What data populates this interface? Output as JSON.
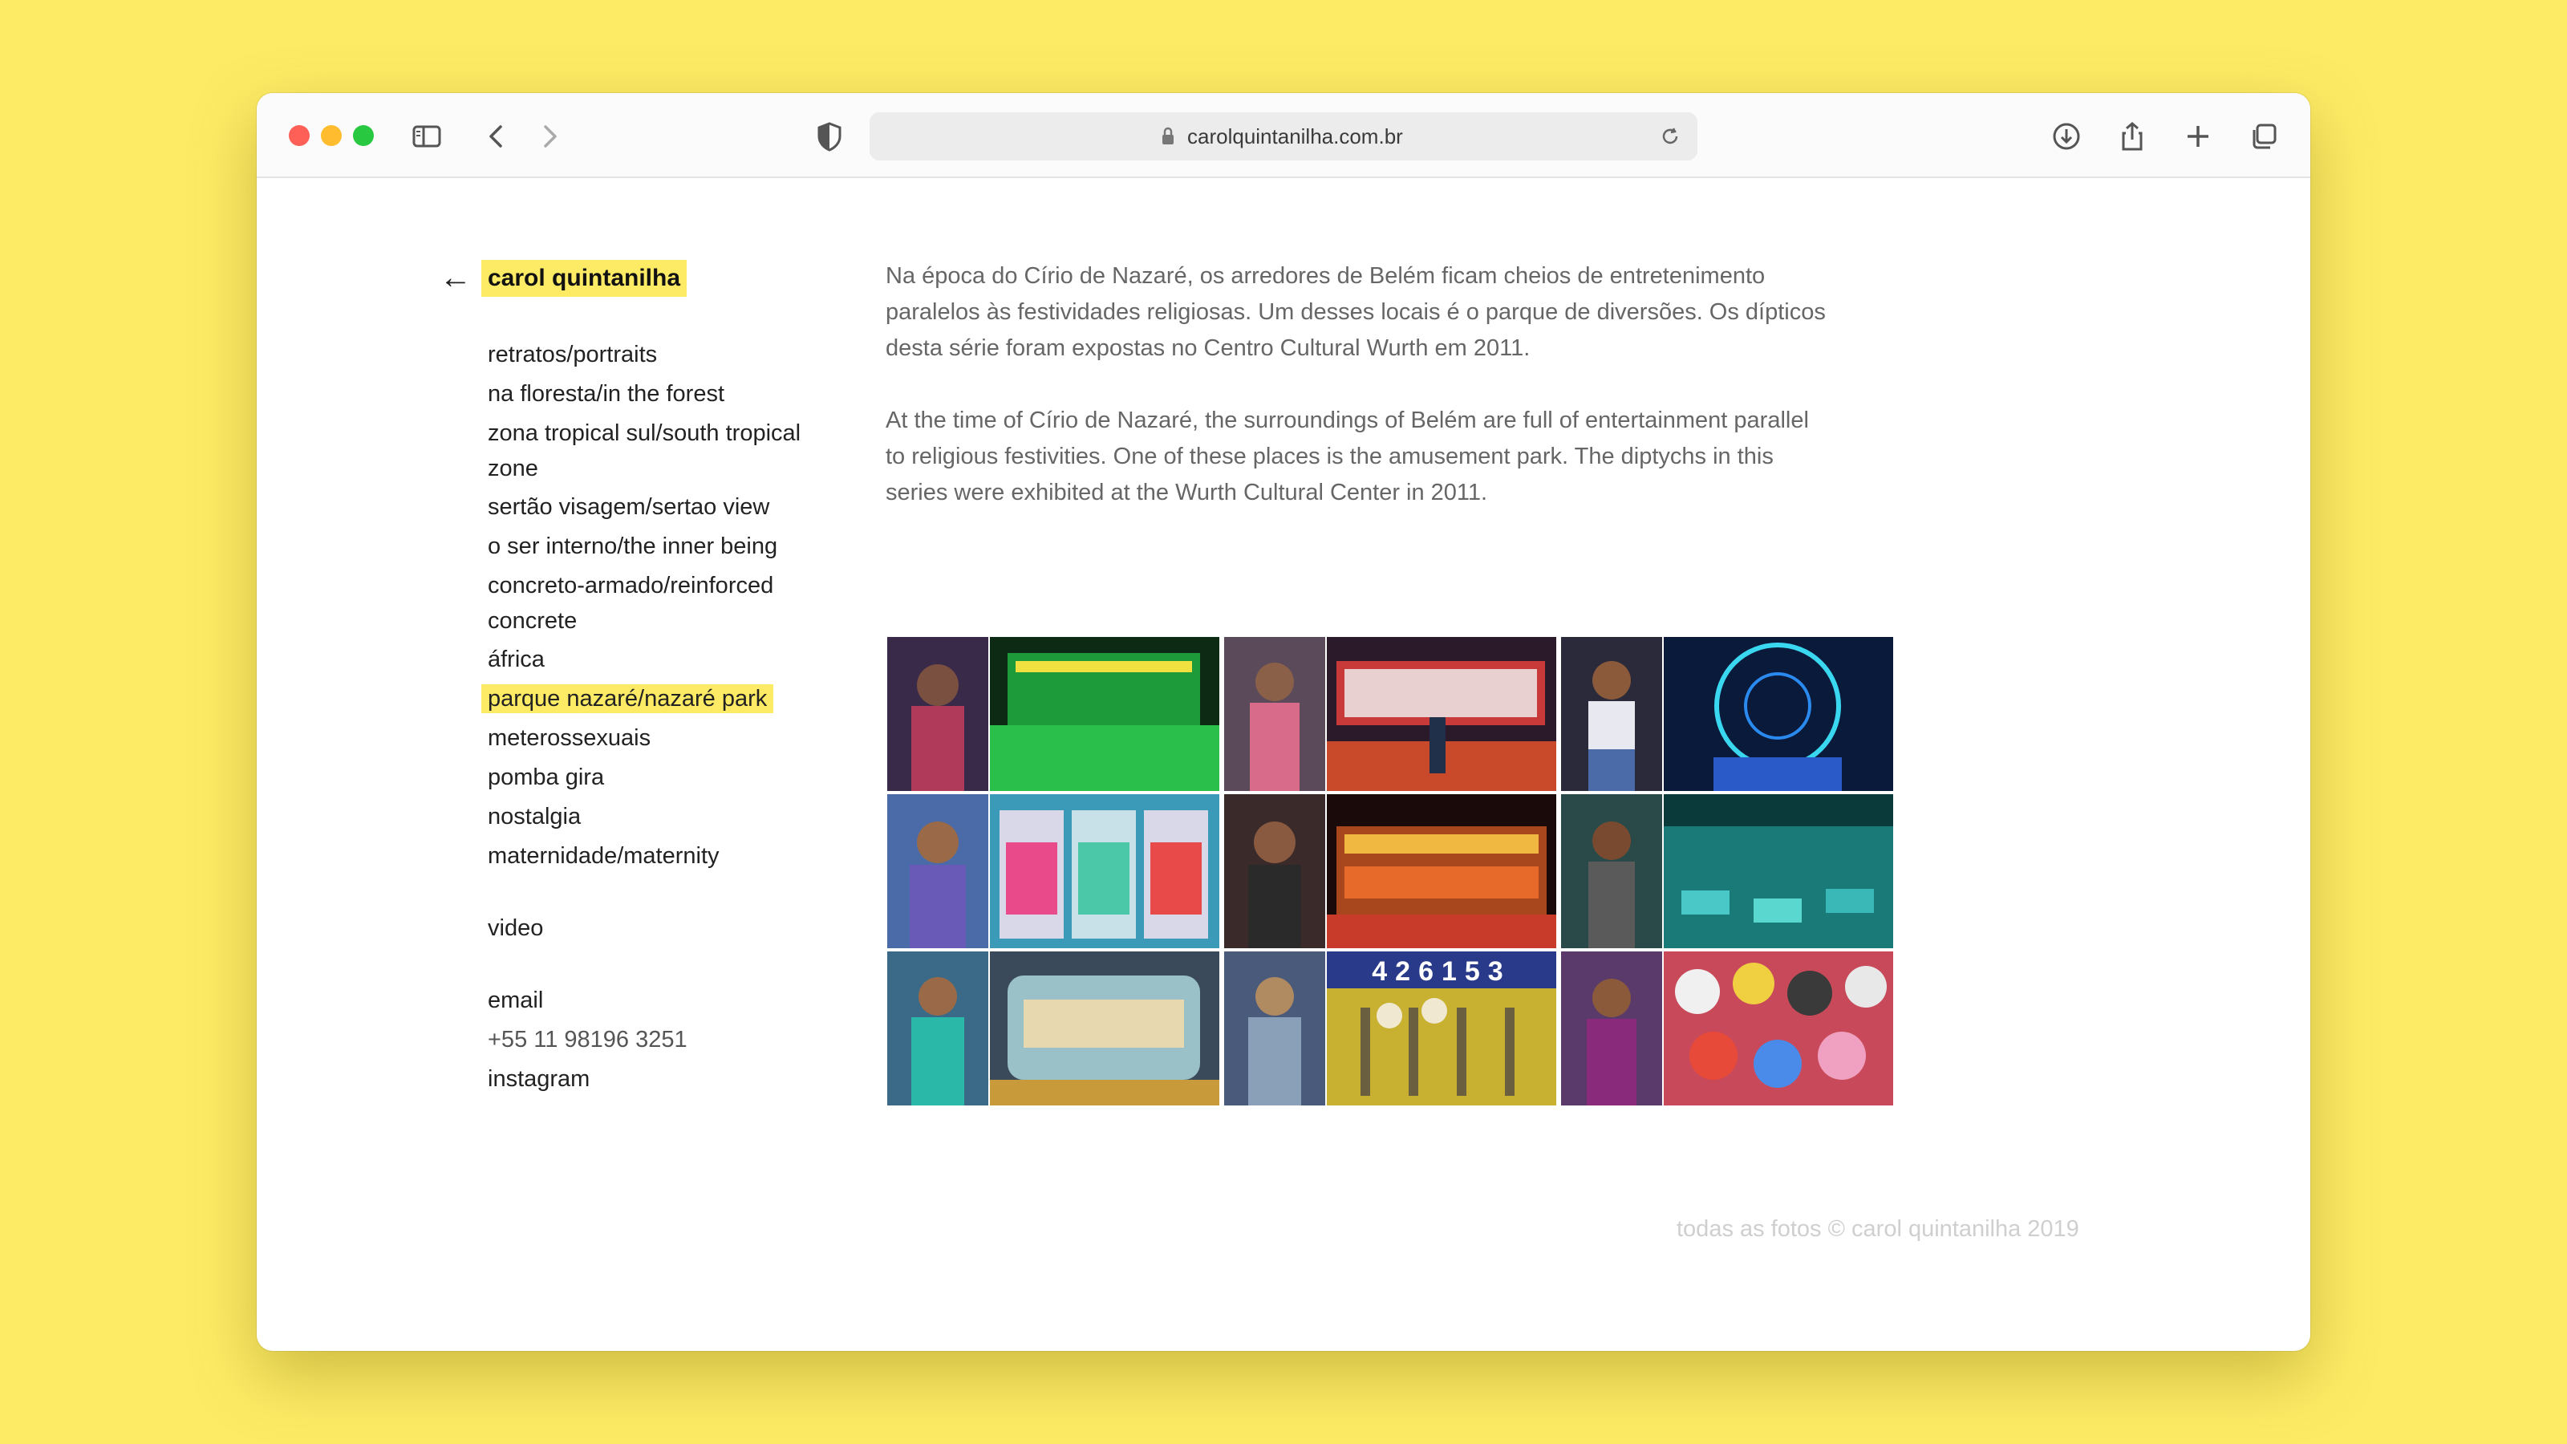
{
  "browser": {
    "url": "carolquintanilha.com.br"
  },
  "site": {
    "back_arrow": "←",
    "title": "carol quintanilha"
  },
  "nav": {
    "items": [
      {
        "label": "retratos/portraits"
      },
      {
        "label": "na floresta/in the forest"
      },
      {
        "label": "zona tropical sul/south tropical zone"
      },
      {
        "label": "sertão visagem/sertao view"
      },
      {
        "label": "o ser interno/the inner being"
      },
      {
        "label": "concreto-armado/reinforced concrete"
      },
      {
        "label": "áfrica"
      },
      {
        "label": "parque nazaré/nazaré park",
        "active": true
      },
      {
        "label": "meterossexuais"
      },
      {
        "label": "pomba gira"
      },
      {
        "label": "nostalgia"
      },
      {
        "label": "maternidade/maternity"
      }
    ],
    "video": "video",
    "email": "email",
    "phone": "+55 11 98196 3251",
    "instagram": "instagram"
  },
  "description": {
    "pt": "Na época do Círio de Nazaré, os arredores de Belém ficam cheios de entretenimento paralelos às festividades religiosas. Um desses locais é o parque de diversões. Os dípticos desta série foram expostas no Centro Cultural Wurth em 2011.",
    "en": "At the time of Círio de Nazaré, the surroundings of Belém are full of entertainment parallel to religious festivities. One of these places is the amusement park. The diptychs in this series were exhibited at the Wurth Cultural Center in 2011."
  },
  "gallery": {
    "tiles": [
      {
        "name": "diptych-1",
        "left_color": "#3a2a4a",
        "right_color": "#1d9a3a"
      },
      {
        "name": "diptych-2",
        "left_color": "#5a4a5a",
        "right_color": "#c83a3a"
      },
      {
        "name": "diptych-3",
        "left_color": "#2a2a3a",
        "right_color": "#0a1a3a"
      },
      {
        "name": "diptych-4",
        "left_color": "#4a6aa8",
        "right_color": "#3a9ab8"
      },
      {
        "name": "diptych-5",
        "left_color": "#3a2a2a",
        "right_color": "#a8461e"
      },
      {
        "name": "diptych-6",
        "left_color": "#2a4a4a",
        "right_color": "#1a7a78"
      },
      {
        "name": "diptych-7",
        "left_color": "#3a6a88",
        "right_color": "#9ac0c8"
      },
      {
        "name": "diptych-8",
        "left_color": "#4a5a7a",
        "right_color": "#c8b030"
      },
      {
        "name": "diptych-9",
        "left_color": "#5a3a6a",
        "right_color": "#c84a5a"
      }
    ],
    "slot_digits": "426153"
  },
  "footer": {
    "text": "todas as fotos © carol quintanilha 2019"
  },
  "colors": {
    "highlight": "#fdeb65",
    "background": "#fdeb65"
  }
}
